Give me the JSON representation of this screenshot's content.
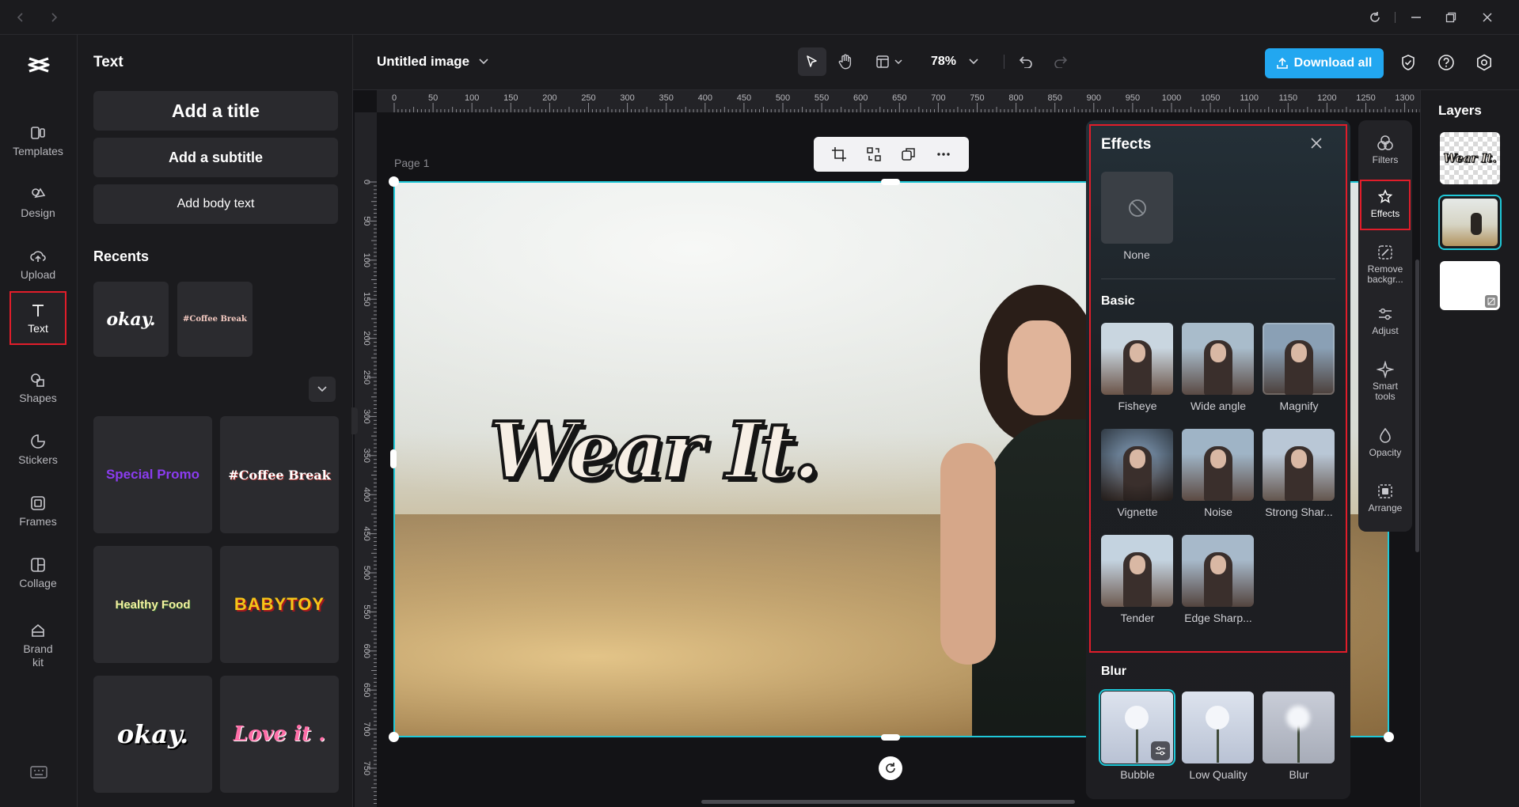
{
  "titlebar": {
    "back": "back-arrow",
    "forward": "forward-arrow"
  },
  "nav": [
    {
      "label": "Templates",
      "icon": "templates-icon"
    },
    {
      "label": "Design",
      "icon": "design-icon"
    },
    {
      "label": "Upload",
      "icon": "upload-icon"
    },
    {
      "label": "Text",
      "icon": "text-icon"
    },
    {
      "label": "Shapes",
      "icon": "shapes-icon"
    },
    {
      "label": "Stickers",
      "icon": "stickers-icon"
    },
    {
      "label": "Frames",
      "icon": "frames-icon"
    },
    {
      "label": "Collage",
      "icon": "collage-icon"
    },
    {
      "label": "Brand kit",
      "icon": "brand-kit-icon"
    }
  ],
  "panel": {
    "title": "Text",
    "add_title": "Add a title",
    "add_subtitle": "Add a subtitle",
    "add_body": "Add body text",
    "recents_label": "Recents",
    "recents": [
      "okay.",
      "#Coffee Break"
    ],
    "templates": [
      "Special Promo",
      "#Coffee Break",
      "Healthy Food",
      "BABYTOY",
      "okay.",
      "Love it ."
    ]
  },
  "topbar": {
    "doc_title": "Untitled image",
    "zoom": "78%",
    "download_label": "Download all"
  },
  "ruler": {
    "h_ticks": [
      "0",
      "50",
      "100",
      "150",
      "200",
      "250",
      "300",
      "350",
      "400",
      "450",
      "500",
      "550",
      "600",
      "650",
      "700",
      "750",
      "800",
      "850",
      "900",
      "950",
      "1000",
      "1050",
      "1100",
      "1150",
      "1200",
      "1250",
      "1300"
    ],
    "v_ticks": [
      "0",
      "50",
      "100",
      "150",
      "200",
      "250",
      "300",
      "350",
      "400",
      "450",
      "500",
      "550",
      "600",
      "650",
      "700",
      "750"
    ]
  },
  "canvas": {
    "page_label": "Page 1",
    "headline": "Wear It."
  },
  "effects": {
    "title": "Effects",
    "none_label": "None",
    "basic_label": "Basic",
    "basic": [
      "Fisheye",
      "Wide angle",
      "Magnify",
      "Vignette",
      "Noise",
      "Strong Shar...",
      "Tender",
      "Edge Sharp..."
    ],
    "blur_label": "Blur",
    "blur": [
      "Bubble",
      "Low Quality",
      "Blur"
    ]
  },
  "tools": [
    {
      "label": "Filters",
      "icon": "filters-icon"
    },
    {
      "label": "Effects",
      "icon": "effects-icon"
    },
    {
      "label": "Remove backgr...",
      "icon": "remove-background-icon"
    },
    {
      "label": "Adjust",
      "icon": "adjust-icon"
    },
    {
      "label": "Smart tools",
      "icon": "smart-tools-icon"
    },
    {
      "label": "Opacity",
      "icon": "opacity-icon"
    },
    {
      "label": "Arrange",
      "icon": "arrange-icon"
    }
  ],
  "layers": {
    "title": "Layers",
    "thumb_text": "Wear It."
  },
  "colors": {
    "accent": "#22a7f0",
    "highlight": "#e11d2a",
    "selection": "#1fc8d8"
  }
}
